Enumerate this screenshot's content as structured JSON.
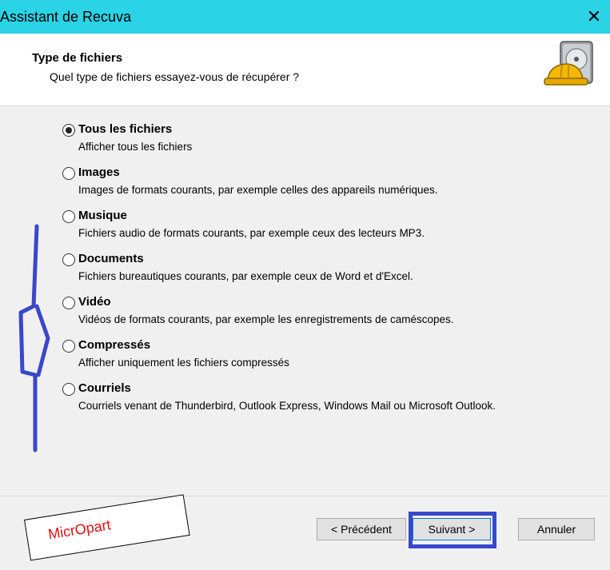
{
  "window": {
    "title": "Assistant de Recuva",
    "close_glyph": "✕",
    "titlebar_color": "#2bd3e6"
  },
  "header": {
    "title": "Type de fichiers",
    "subtitle": "Quel type de fichiers essayez-vous de récupérer ?",
    "icon": "hard-drive-with-hard-hat-icon"
  },
  "options": [
    {
      "label": "Tous les fichiers",
      "description": "Afficher tous les fichiers",
      "checked": true
    },
    {
      "label": "Images",
      "description": "Images de formats courants, par exemple celles des appareils numériques.",
      "checked": false
    },
    {
      "label": "Musique",
      "description": "Fichiers audio de formats courants, par exemple ceux des lecteurs MP3.",
      "checked": false
    },
    {
      "label": "Documents",
      "description": "Fichiers bureautiques courants, par exemple ceux de Word et d'Excel.",
      "checked": false
    },
    {
      "label": "Vidéo",
      "description": "Vidéos de formats courants, par exemple les enregistrements de caméscopes.",
      "checked": false
    },
    {
      "label": "Compressés",
      "description": "Afficher uniquement les fichiers compressés",
      "checked": false
    },
    {
      "label": "Courriels",
      "description": "Courriels venant de Thunderbird, Outlook Express, Windows Mail ou Microsoft Outlook.",
      "checked": false
    }
  ],
  "buttons": {
    "previous": "< Précédent",
    "next": "Suivant >",
    "cancel": "Annuler"
  },
  "watermark": {
    "text": "MicrOpart",
    "color": "#e01010"
  },
  "annotation_color": "#3948c8"
}
